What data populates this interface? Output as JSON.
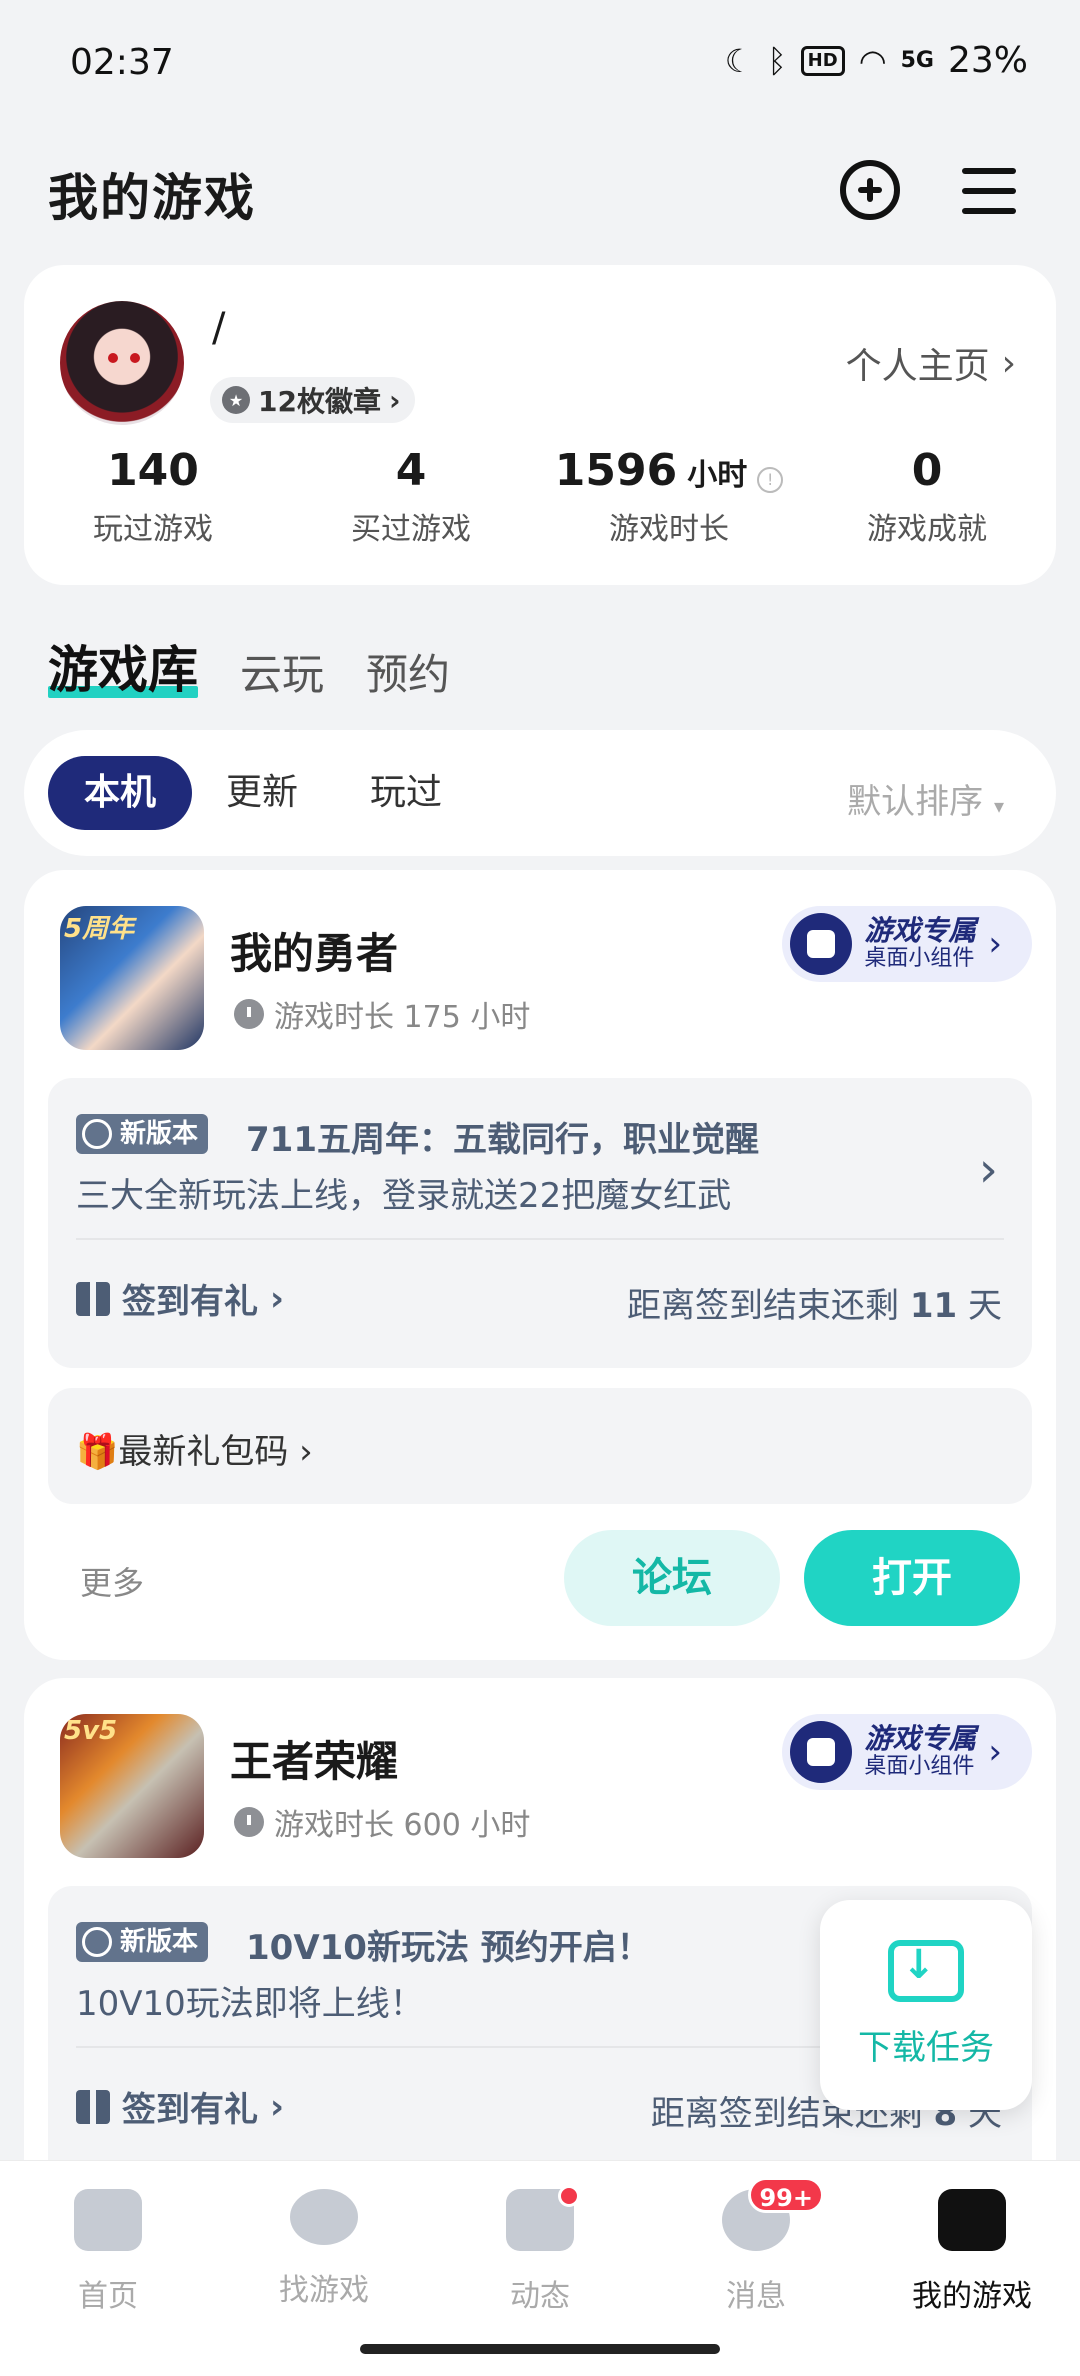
{
  "status_bar": {
    "time": "02:37",
    "battery": "23%",
    "network": "5G",
    "hd": "HD"
  },
  "header": {
    "title": "我的游戏"
  },
  "profile": {
    "username": "/",
    "badges": "12枚徽章",
    "homepage_link": "个人主页",
    "stats": [
      {
        "value": "140",
        "unit": "",
        "label": "玩过游戏"
      },
      {
        "value": "4",
        "unit": "",
        "label": "买过游戏"
      },
      {
        "value": "1596",
        "unit": "小时",
        "label": "游戏时长"
      },
      {
        "value": "0",
        "unit": "",
        "label": "游戏成就"
      }
    ]
  },
  "tabs": [
    "游戏库",
    "云玩",
    "预约"
  ],
  "filters": {
    "items": [
      "本机",
      "更新",
      "玩过"
    ],
    "sort": "默认排序"
  },
  "widget": {
    "title": "游戏专属",
    "subtitle": "桌面小组件"
  },
  "games": [
    {
      "name": "我的勇者",
      "icon_tag": "5周年",
      "playtime": "游戏时长 175 小时",
      "new_badge": "新版本",
      "news_title": "711五周年：五载同行，职业觉醒",
      "news_desc": "三大全新玩法上线，登录就送22把魔女红武",
      "signin": "签到有礼",
      "countdown_prefix": "距离签到结束还剩",
      "countdown_days": "11",
      "countdown_suffix": "天",
      "giftcode": "🎁最新礼包码",
      "more": "更多",
      "forum": "论坛",
      "open": "打开"
    },
    {
      "name": "王者荣耀",
      "icon_tag": "5v5",
      "playtime": "游戏时长 600 小时",
      "new_badge": "新版本",
      "news_title": "10V10新玩法 预约开启！",
      "news_desc": "10V10玩法即将上线！",
      "signin": "签到有礼",
      "countdown_prefix": "距离签到结束还剩",
      "countdown_days": "8",
      "countdown_suffix": "天"
    }
  ],
  "download_task": {
    "label": "下载任务"
  },
  "bottom_nav": [
    {
      "label": "首页",
      "icon": "home-icon"
    },
    {
      "label": "找游戏",
      "icon": "planet-icon"
    },
    {
      "label": "动态",
      "icon": "feed-icon",
      "dot": true
    },
    {
      "label": "消息",
      "icon": "message-icon",
      "badge": "99+"
    },
    {
      "label": "我的游戏",
      "icon": "gamepad-icon",
      "active": true
    }
  ]
}
